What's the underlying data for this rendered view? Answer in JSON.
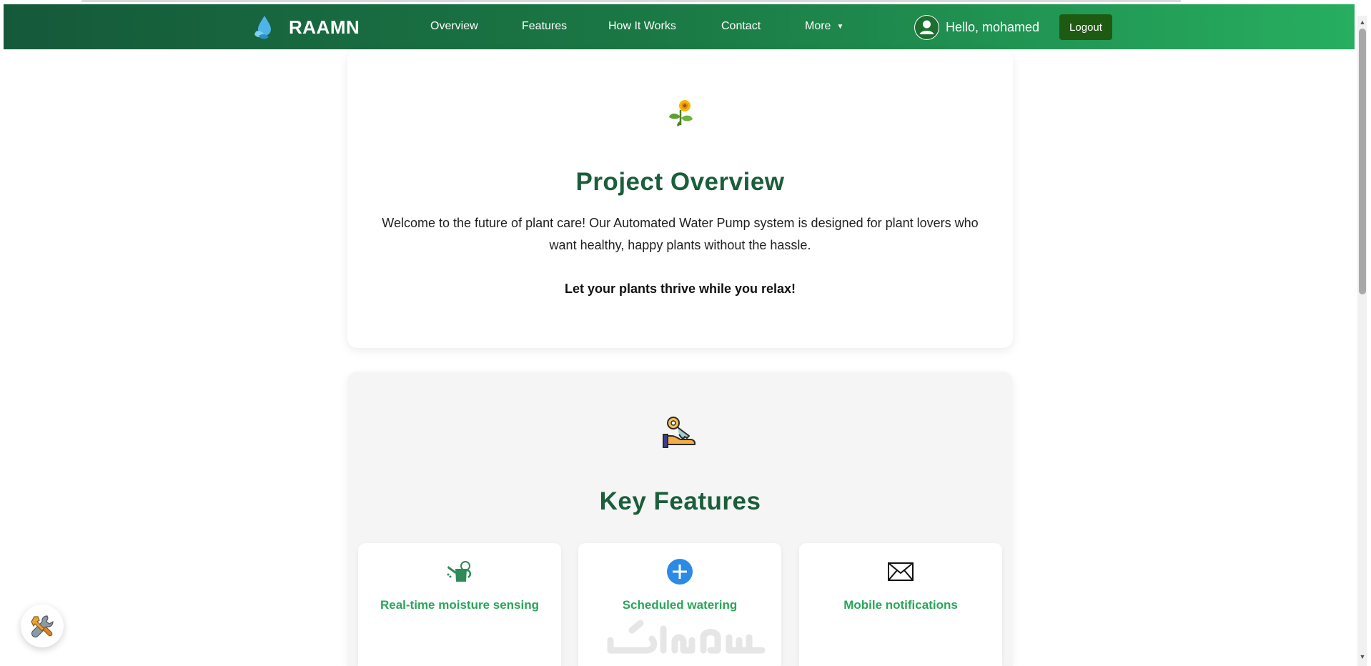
{
  "brand": {
    "name": "RAAMN",
    "icon": "water-drop-leaf-icon"
  },
  "nav": {
    "links": [
      "Overview",
      "Features",
      "How It Works",
      "Contact"
    ],
    "more_label": "More",
    "more_caret": "▼"
  },
  "user": {
    "greeting": "Hello, mohamed",
    "avatar_icon": "user-avatar-icon"
  },
  "logout_label": "Logout",
  "overview": {
    "icon": "sunflower-icon",
    "title": "Project Overview",
    "description": "Welcome to the future of plant care! Our Automated Water Pump system is designed for plant lovers who want healthy, happy plants without the hassle.",
    "tagline": "Let your plants thrive while you relax!"
  },
  "features": {
    "icon": "hand-with-key-icon",
    "title": "Key Features",
    "items": [
      {
        "label": "Real-time moisture sensing",
        "icon": "watering-can-icon"
      },
      {
        "label": "Scheduled watering",
        "icon": "plus-circle-icon"
      },
      {
        "label": "Mobile notifications",
        "icon": "envelope-icon"
      }
    ]
  },
  "watermark_icon": "khamsat-watermark-icon",
  "fab_icon": "tools-icon",
  "colors": {
    "nav_start": "#15593a",
    "nav_end": "#27ae60",
    "title_green": "#1a5e3a",
    "feature_green": "#2aa55a",
    "logout_bg": "#1e5a12",
    "plus_blue": "#2a8ae6"
  }
}
